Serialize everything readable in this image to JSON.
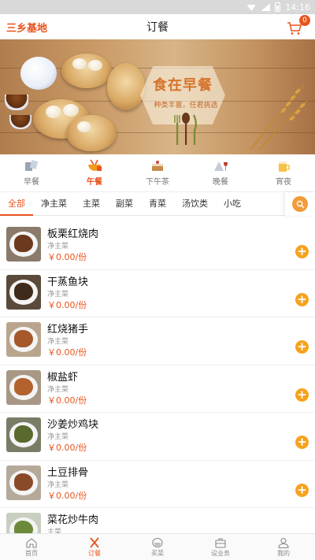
{
  "status_bar": {
    "time": "14:16"
  },
  "header": {
    "location": "三乡基地",
    "title": "订餐",
    "cart_count": "0"
  },
  "banner": {
    "slogan": "食在早餐",
    "sub": "种类丰富，任君挑选"
  },
  "meal_tabs": [
    {
      "label": "早餐",
      "icon": "breakfast-icon",
      "active": false
    },
    {
      "label": "午餐",
      "icon": "lunch-icon",
      "active": true
    },
    {
      "label": "下午茶",
      "icon": "afternoon-tea-icon",
      "active": false
    },
    {
      "label": "晚餐",
      "icon": "dinner-icon",
      "active": false
    },
    {
      "label": "宵夜",
      "icon": "late-night-snack-icon",
      "active": false
    }
  ],
  "categories": [
    {
      "label": "全部",
      "active": true
    },
    {
      "label": "净主菜",
      "active": false
    },
    {
      "label": "主菜",
      "active": false
    },
    {
      "label": "副菜",
      "active": false
    },
    {
      "label": "青菜",
      "active": false
    },
    {
      "label": "汤饮类",
      "active": false
    },
    {
      "label": "小吃",
      "active": false
    }
  ],
  "items": [
    {
      "name": "板栗红烧肉",
      "category": "净主菜",
      "price": "￥0.00/份",
      "color": "#6b3a1e"
    },
    {
      "name": "干蒸鱼块",
      "category": "净主菜",
      "price": "￥0.00/份",
      "color": "#3f2b1c"
    },
    {
      "name": "红烧猪手",
      "category": "净主菜",
      "price": "￥0.00/份",
      "color": "#a5582a"
    },
    {
      "name": "椒盐虾",
      "category": "净主菜",
      "price": "￥0.00/份",
      "color": "#b3622e"
    },
    {
      "name": "沙姜炒鸡块",
      "category": "净主菜",
      "price": "￥0.00/份",
      "color": "#5a6a2e"
    },
    {
      "name": "土豆排骨",
      "category": "净主菜",
      "price": "￥0.00/份",
      "color": "#8a4a2a"
    },
    {
      "name": "菜花炒牛肉",
      "category": "主菜",
      "price": "",
      "color": "#6d8a3a"
    }
  ],
  "bottom_nav": [
    {
      "label": "首页",
      "icon": "home-icon",
      "active": false
    },
    {
      "label": "订餐",
      "icon": "fork-knife-icon",
      "active": true
    },
    {
      "label": "买菜",
      "icon": "vegetable-basket-icon",
      "active": false
    },
    {
      "label": "设业务",
      "icon": "briefcase-icon",
      "active": false
    },
    {
      "label": "我的",
      "icon": "user-icon",
      "active": false
    }
  ],
  "colors": {
    "accent": "#e8541e",
    "add_button": "#f6a21e"
  }
}
